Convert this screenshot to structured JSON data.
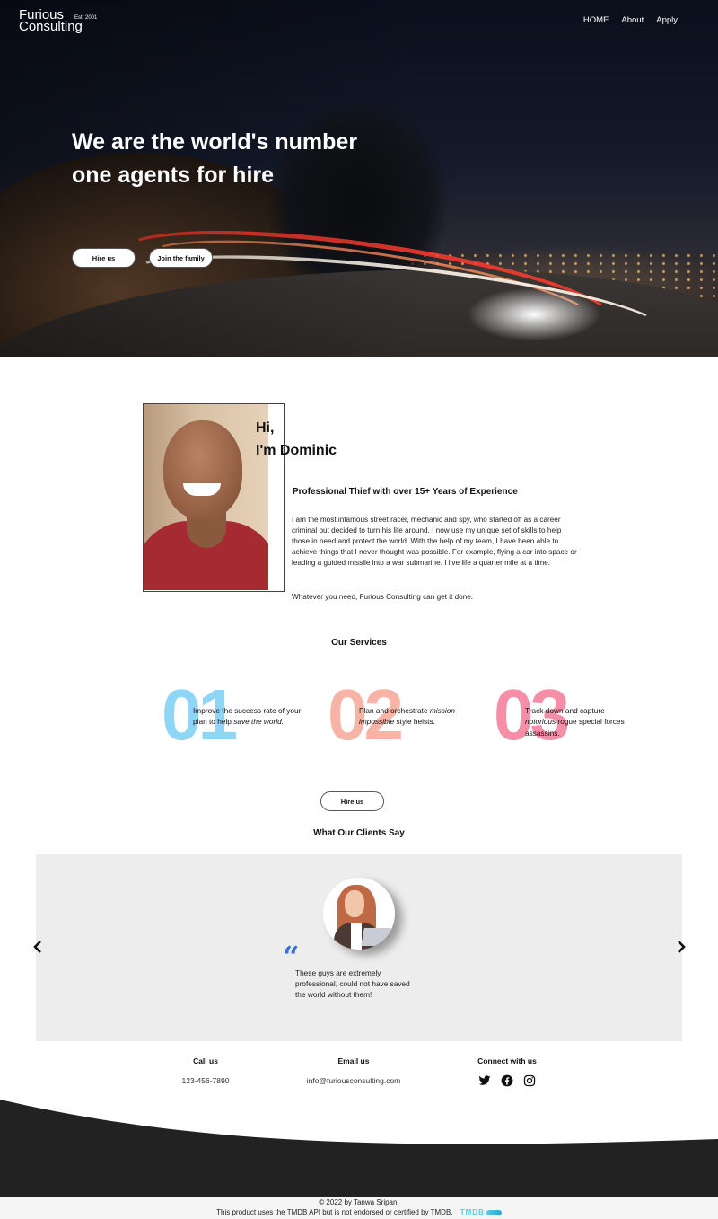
{
  "nav": {
    "logo_line1": "Furious",
    "logo_line2": "Consulting",
    "logo_est": "Est. 2001",
    "links": [
      "HOME",
      "About",
      "Apply"
    ]
  },
  "hero": {
    "title": "We are the world's number one agents for hire",
    "buttons": {
      "hire": "Hire us",
      "join": "Join the family"
    }
  },
  "about": {
    "greeting_line1": "Hi,",
    "greeting_line2": "I'm Dominic",
    "subtitle": "Professional Thief with over 15+ Years of Experience",
    "bio": "I am the most infamous street racer, mechanic and spy, who started off as a career criminal but decided to turn his life around. I now use my unique set of skills to help those in need and protect the world. With the help of my team, I have been able to achieve things that I never thought was possible. For example, flying a car into space or leading a guided missile into a war submarine. I live life a quarter mile at a time.",
    "closing": "Whatever you need, Furious Consulting can get it done."
  },
  "services": {
    "title": "Our Services",
    "items": [
      {
        "number": "01",
        "text_before": "Improve the success rate of your plan to help ",
        "emphasis": "save the world.",
        "text_after": "",
        "color": "#8ed6f6"
      },
      {
        "number": "02",
        "text_before": "Plan and orchestrate ",
        "emphasis": "mission impossible",
        "text_after": " style heists.",
        "color": "#f7b3a6"
      },
      {
        "number": "03",
        "text_before": "Track down and capture ",
        "emphasis": "notorious",
        "text_after": " rogue special forces assassins.",
        "color": "#f58ea6"
      }
    ],
    "cta": "Hire us"
  },
  "clients": {
    "title": "What Our Clients Say",
    "quote_icon": "quote-icon",
    "quote": "These guys are extremely professional, could not have saved the world without them!"
  },
  "contact": {
    "call": {
      "label": "Call us",
      "value": "123-456-7890"
    },
    "email": {
      "label": "Email us",
      "value": "info@furiousconsulting.com"
    },
    "connect": {
      "label": "Connect with us",
      "icons": [
        "twitter-icon",
        "facebook-icon",
        "instagram-icon"
      ]
    }
  },
  "footer": {
    "copyright": "© 2022 by Tanwa Sripan.",
    "disclaimer": "This product uses the TMDB API but is not endorsed or certified by TMDB.",
    "tmdb_logo": "TMDB"
  },
  "colors": {
    "accent_blue": "#3a6fe0",
    "footer_dark": "#222222",
    "testimonial_bg": "#ededed"
  }
}
